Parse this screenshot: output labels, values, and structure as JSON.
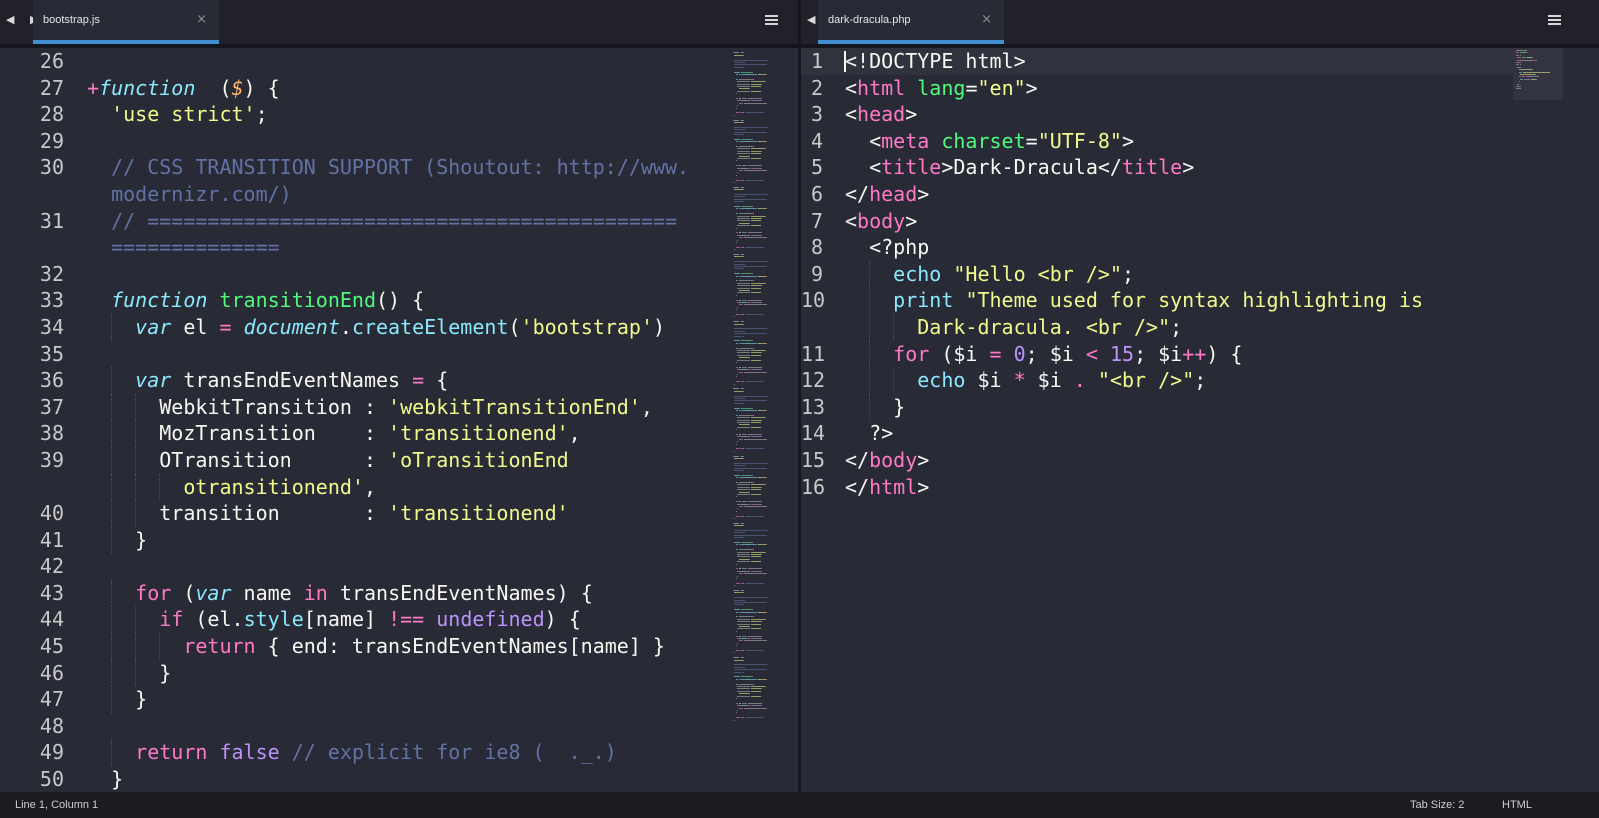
{
  "left_pane": {
    "tab": {
      "title": "bootstrap.js",
      "close": "×"
    },
    "nav_arrows": "◀ ▶",
    "lines": [
      {
        "n": "26",
        "tokens": []
      },
      {
        "n": "27",
        "tokens": [
          [
            "kw",
            "+"
          ],
          [
            "it",
            "function"
          ],
          [
            "",
            "  ("
          ],
          [
            "ar",
            "$"
          ],
          [
            "",
            ") {"
          ]
        ]
      },
      {
        "n": "28",
        "tokens": [
          [
            "",
            "  "
          ],
          [
            "st",
            "'use strict'"
          ],
          [
            "",
            ";"
          ]
        ]
      },
      {
        "n": "29",
        "tokens": []
      },
      {
        "n": "30",
        "tokens": [
          [
            "",
            "  "
          ],
          [
            "cm",
            "// CSS TRANSITION SUPPORT (Shoutout: http://www."
          ]
        ]
      },
      {
        "n": "",
        "tokens": [
          [
            "",
            "  "
          ],
          [
            "cm",
            "modernizr.com/)"
          ]
        ]
      },
      {
        "n": "31",
        "tokens": [
          [
            "",
            "  "
          ],
          [
            "cm",
            "// ============================================"
          ]
        ]
      },
      {
        "n": "",
        "tokens": [
          [
            "",
            "  "
          ],
          [
            "cm",
            "=============="
          ]
        ]
      },
      {
        "n": "32",
        "tokens": []
      },
      {
        "n": "33",
        "tokens": [
          [
            "",
            "  "
          ],
          [
            "it",
            "function"
          ],
          [
            "",
            " "
          ],
          [
            "fn",
            "transitionEnd"
          ],
          [
            "",
            "() {"
          ]
        ]
      },
      {
        "n": "34",
        "tokens": [
          [
            "",
            "    "
          ],
          [
            "it",
            "var"
          ],
          [
            "",
            " el "
          ],
          [
            "kw",
            "="
          ],
          [
            "",
            " "
          ],
          [
            "it",
            "document"
          ],
          [
            "",
            "."
          ],
          [
            "cy",
            "createElement"
          ],
          [
            "",
            "("
          ],
          [
            "st",
            "'bootstrap'"
          ],
          [
            "",
            ")"
          ]
        ]
      },
      {
        "n": "35",
        "tokens": []
      },
      {
        "n": "36",
        "tokens": [
          [
            "",
            "    "
          ],
          [
            "it",
            "var"
          ],
          [
            "",
            " transEndEventNames "
          ],
          [
            "kw",
            "="
          ],
          [
            "",
            " {"
          ]
        ]
      },
      {
        "n": "37",
        "tokens": [
          [
            "",
            "      WebkitTransition : "
          ],
          [
            "st",
            "'webkitTransitionEnd'"
          ],
          [
            "",
            ","
          ]
        ]
      },
      {
        "n": "38",
        "tokens": [
          [
            "",
            "      MozTransition    : "
          ],
          [
            "st",
            "'transitionend'"
          ],
          [
            "",
            ","
          ]
        ]
      },
      {
        "n": "39",
        "tokens": [
          [
            "",
            "      OTransition      : "
          ],
          [
            "st",
            "'oTransitionEnd"
          ]
        ]
      },
      {
        "n": "",
        "tokens": [
          [
            "",
            "        "
          ],
          [
            "st",
            "otransitionend'"
          ],
          [
            "",
            ","
          ]
        ]
      },
      {
        "n": "40",
        "tokens": [
          [
            "",
            "      transition       : "
          ],
          [
            "st",
            "'transitionend'"
          ]
        ]
      },
      {
        "n": "41",
        "tokens": [
          [
            "",
            "    }"
          ]
        ]
      },
      {
        "n": "42",
        "tokens": []
      },
      {
        "n": "43",
        "tokens": [
          [
            "",
            "    "
          ],
          [
            "kw",
            "for"
          ],
          [
            "",
            " ("
          ],
          [
            "it",
            "var"
          ],
          [
            "",
            " name "
          ],
          [
            "kw",
            "in"
          ],
          [
            "",
            " transEndEventNames) {"
          ]
        ]
      },
      {
        "n": "44",
        "tokens": [
          [
            "",
            "      "
          ],
          [
            "kw",
            "if"
          ],
          [
            "",
            " (el."
          ],
          [
            "cy",
            "style"
          ],
          [
            "",
            "[name] "
          ],
          [
            "kw",
            "!=="
          ],
          [
            "",
            " "
          ],
          [
            "pu",
            "undefined"
          ],
          [
            "",
            ") {"
          ]
        ]
      },
      {
        "n": "45",
        "tokens": [
          [
            "",
            "        "
          ],
          [
            "kw",
            "return"
          ],
          [
            "",
            " { end: transEndEventNames[name] }"
          ]
        ]
      },
      {
        "n": "46",
        "tokens": [
          [
            "",
            "      }"
          ]
        ]
      },
      {
        "n": "47",
        "tokens": [
          [
            "",
            "    }"
          ]
        ]
      },
      {
        "n": "48",
        "tokens": []
      },
      {
        "n": "49",
        "tokens": [
          [
            "",
            "    "
          ],
          [
            "kw",
            "return"
          ],
          [
            "",
            " "
          ],
          [
            "pu",
            "false"
          ],
          [
            "",
            " "
          ],
          [
            "cm",
            "// explicit for ie8 (  ._.)"
          ]
        ]
      },
      {
        "n": "50",
        "tokens": [
          [
            "",
            "  }"
          ]
        ]
      }
    ]
  },
  "right_pane": {
    "tab": {
      "title": "dark-dracula.php",
      "close": "×"
    },
    "nav_arrows": "◀ ▶",
    "lines": [
      {
        "n": "1",
        "tokens": [
          [
            "",
            "<!DOCTYPE html>"
          ]
        ]
      },
      {
        "n": "2",
        "tokens": [
          [
            "",
            "<"
          ],
          [
            "kw",
            "html"
          ],
          [
            "",
            " "
          ],
          [
            "fn",
            "lang"
          ],
          [
            "",
            "="
          ],
          [
            "st",
            "\"en\""
          ],
          [
            "",
            ">"
          ]
        ]
      },
      {
        "n": "3",
        "tokens": [
          [
            "",
            "<"
          ],
          [
            "kw",
            "head"
          ],
          [
            "",
            ">"
          ]
        ]
      },
      {
        "n": "4",
        "tokens": [
          [
            "",
            "  <"
          ],
          [
            "kw",
            "meta"
          ],
          [
            "",
            " "
          ],
          [
            "fn",
            "charset"
          ],
          [
            "",
            "="
          ],
          [
            "st",
            "\"UTF-8\""
          ],
          [
            "",
            ">"
          ]
        ]
      },
      {
        "n": "5",
        "tokens": [
          [
            "",
            "  <"
          ],
          [
            "kw",
            "title"
          ],
          [
            "",
            ">Dark-Dracula</"
          ],
          [
            "kw",
            "title"
          ],
          [
            "",
            ">"
          ]
        ]
      },
      {
        "n": "6",
        "tokens": [
          [
            "",
            "</"
          ],
          [
            "kw",
            "head"
          ],
          [
            "",
            ">"
          ]
        ]
      },
      {
        "n": "7",
        "tokens": [
          [
            "",
            "<"
          ],
          [
            "kw",
            "body"
          ],
          [
            "",
            ">"
          ]
        ]
      },
      {
        "n": "8",
        "tokens": [
          [
            "",
            "  <?php"
          ]
        ]
      },
      {
        "n": "9",
        "tokens": [
          [
            "",
            "    "
          ],
          [
            "cy",
            "echo"
          ],
          [
            "",
            " "
          ],
          [
            "st",
            "\"Hello <br />\""
          ],
          [
            "",
            ";"
          ]
        ]
      },
      {
        "n": "10",
        "tokens": [
          [
            "",
            "    "
          ],
          [
            "cy",
            "print"
          ],
          [
            "",
            " "
          ],
          [
            "st",
            "\"Theme used for syntax highlighting is"
          ]
        ]
      },
      {
        "n": "",
        "tokens": [
          [
            "",
            "      "
          ],
          [
            "st",
            "Dark-dracula. <br />\""
          ],
          [
            "",
            ";"
          ]
        ]
      },
      {
        "n": "11",
        "tokens": [
          [
            "",
            "    "
          ],
          [
            "kw",
            "for"
          ],
          [
            "",
            " ($i "
          ],
          [
            "kw",
            "="
          ],
          [
            "",
            " "
          ],
          [
            "pu",
            "0"
          ],
          [
            "",
            "; $i "
          ],
          [
            "kw",
            "<"
          ],
          [
            "",
            " "
          ],
          [
            "pu",
            "15"
          ],
          [
            "",
            "; $i"
          ],
          [
            "kw",
            "++"
          ],
          [
            "",
            ") {"
          ]
        ]
      },
      {
        "n": "12",
        "tokens": [
          [
            "",
            "      "
          ],
          [
            "cy",
            "echo"
          ],
          [
            "",
            " $i "
          ],
          [
            "kw",
            "*"
          ],
          [
            "",
            " $i "
          ],
          [
            "kw",
            "."
          ],
          [
            "",
            " "
          ],
          [
            "st",
            "\"<br />\""
          ],
          [
            "",
            ";"
          ]
        ]
      },
      {
        "n": "13",
        "tokens": [
          [
            "",
            "    }"
          ]
        ]
      },
      {
        "n": "14",
        "tokens": [
          [
            "",
            "  ?>"
          ]
        ]
      },
      {
        "n": "15",
        "tokens": [
          [
            "",
            "</"
          ],
          [
            "kw",
            "body"
          ],
          [
            "",
            ">"
          ]
        ]
      },
      {
        "n": "16",
        "tokens": [
          [
            "",
            "</"
          ],
          [
            "kw",
            "html"
          ],
          [
            "",
            ">"
          ]
        ]
      }
    ]
  },
  "status": {
    "position": "Line 1, Column 1",
    "tab_size": "Tab Size: 2",
    "syntax": "HTML"
  },
  "colors": {
    "background": "#282a36",
    "keyword": "#ff79c6",
    "string": "#f1fa8c",
    "comment": "#6272a4",
    "function": "#50fa7b",
    "storage": "#8be9fd",
    "constant": "#bd93f9",
    "accent": "#3e8ed0"
  },
  "icons": [
    "nav-arrows-icon",
    "close-icon",
    "menu-icon"
  ]
}
